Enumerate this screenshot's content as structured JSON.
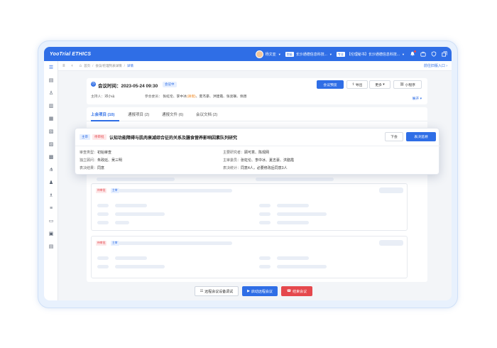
{
  "app": {
    "brand": "YooTrial ETHICS",
    "user_name": "杨文亚",
    "org_tag": "院级",
    "org_name": "长沙通德信息科技...",
    "role_tag": "专业",
    "role_name": "【伦理秘书】长沙通德信息科技...",
    "notification_count": "1"
  },
  "breadcrumb": {
    "items": [
      "首页",
      "会议/伦理列表详情",
      "详情"
    ],
    "go_label": "前往旧版入口"
  },
  "meeting": {
    "time_label": "会议时间：2023-05-24 09:30",
    "status": "会议中",
    "host_label": "主持人：",
    "host": "邓小山",
    "members_label": "参会委员：",
    "members_before": "张虹伦、李中冰",
    "members_highlight": "(请假)",
    "members_after": "、夏杰豪、洪建霞、张亮联、佩善",
    "buttons": {
      "preview": "会议预览",
      "export": "导出",
      "more": "更多",
      "mini_program": "小程序"
    },
    "expand": "展开"
  },
  "tabs": [
    {
      "label": "上会项目 (10)",
      "active": true
    },
    {
      "label": "通报项目 (2)",
      "active": false
    },
    {
      "label": "通报文件 (6)",
      "active": false
    },
    {
      "label": "会议文档 (2)",
      "active": false
    }
  ],
  "popup": {
    "type_tag": "主审",
    "status_tag": "待审批",
    "title": "认知功能障碍与肌肉衰减综合征的关系及膳食营养影响因素队列研究",
    "buttons": {
      "next": "下会",
      "decide": "表决追溯"
    },
    "fields_left": [
      {
        "label": "审查类型：",
        "value": "初始审查"
      },
      {
        "label": "独立顾问：",
        "value": "朱政廷、吴三明"
      },
      {
        "label": "表决结果：",
        "value": "同意"
      }
    ],
    "fields_right": [
      {
        "label": "主要研究者：",
        "value": "顾可意、陈观网"
      },
      {
        "label": "主审委员：",
        "value": "张虹伦、李中冰、夏志豪、洪膳霞"
      },
      {
        "label": "表决统计：",
        "value": "同意4人，必要修改后同意3人"
      }
    ]
  },
  "cards": [
    {
      "tag1": "待审批",
      "tag2": "主审"
    },
    {
      "tag1": "待审批",
      "tag2": "主审"
    }
  ],
  "bottom_bar": {
    "debug": "远程会议设备调试",
    "start_remote": "启动远程会议",
    "end_meeting": "结束会议"
  },
  "colors": {
    "primary": "#2f6ee6",
    "danger": "#e5484d",
    "warning": "#f08a24"
  }
}
